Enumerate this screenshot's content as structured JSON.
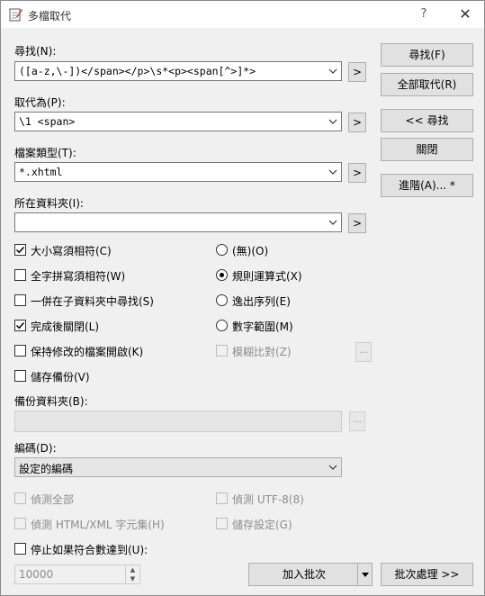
{
  "window": {
    "title": "多檔取代",
    "help": "?",
    "close": "✕"
  },
  "find": {
    "label": "尋找(N):",
    "value": "([a-z,\\-])</span></p>\\s*<p><span[^>]*>"
  },
  "replace": {
    "label": "取代為(P):",
    "value": "\\1 <span>"
  },
  "filetype": {
    "label": "檔案類型(T):",
    "value": "*.xhtml"
  },
  "folder": {
    "label": "所在資料夾(I):",
    "value": ""
  },
  "arrow_button": ">",
  "buttons": {
    "find": "尋找(F)",
    "replace_all": "全部取代(R)",
    "back_find": "<< 尋找",
    "close": "關閉",
    "advanced": "進階(A)... *",
    "add_batch": "加入批次",
    "batch_process": "批次處理 >>"
  },
  "options": {
    "match_case": {
      "label": "大小寫須相符(C)",
      "checked": true
    },
    "whole_word": {
      "label": "全字拼寫須相符(W)",
      "checked": false
    },
    "subfolders": {
      "label": "一併在子資料夾中尋找(S)",
      "checked": false
    },
    "close_after": {
      "label": "完成後關閉(L)",
      "checked": true
    },
    "keep_open": {
      "label": "保持修改的檔案開啟(K)",
      "checked": false
    },
    "backup": {
      "label": "儲存備份(V)",
      "checked": false
    }
  },
  "modes": {
    "none": {
      "label": "(無)(O)",
      "selected": false
    },
    "regex": {
      "label": "規則運算式(X)",
      "selected": true
    },
    "escape": {
      "label": "逸出序列(E)",
      "selected": false
    },
    "numeric": {
      "label": "數字範圍(M)",
      "selected": false
    },
    "fuzzy": {
      "label": "模糊比對(Z)",
      "disabled": true
    }
  },
  "ellipsis": "...",
  "backup_folder": {
    "label": "備份資料夾(B):",
    "value": ""
  },
  "encoding": {
    "label": "編碼(D):",
    "value": "設定的編碼"
  },
  "detect": {
    "all": "偵測全部",
    "utf8": "偵測 UTF-8(8)",
    "html_charset": "偵測 HTML/XML 字元集(H)",
    "save_settings": "儲存設定(G)"
  },
  "stop_if": {
    "label": "停止如果符合數達到(U):",
    "checked": false,
    "value": "10000"
  }
}
